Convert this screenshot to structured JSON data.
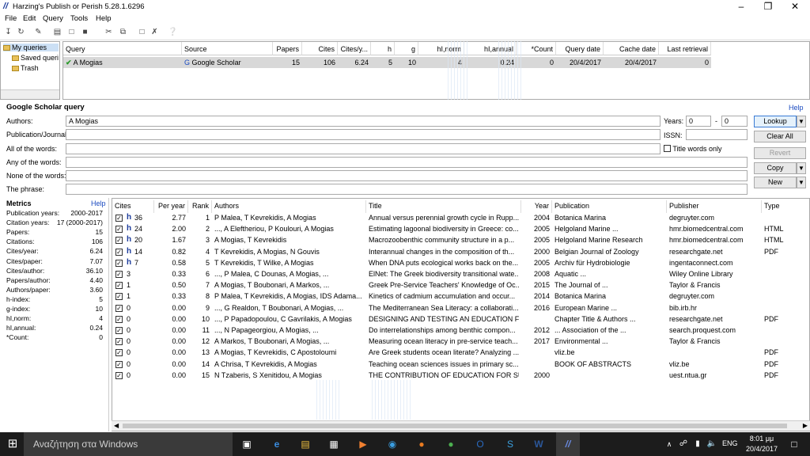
{
  "window": {
    "title": "Harzing's Publish or Perish 5.28.1.6296",
    "logo": "//"
  },
  "menu": [
    "File",
    "Edit",
    "Query",
    "Tools",
    "Help"
  ],
  "tree": {
    "items": [
      "My queries",
      "Saved queri",
      "Trash"
    ]
  },
  "queries": {
    "headers": [
      "Query",
      "Source",
      "Papers",
      "Cites",
      "Cites/y...",
      "h",
      "g",
      "hI,norm",
      "hI,annual",
      "*Count",
      "Query date",
      "Cache date",
      "Last retrieval"
    ],
    "row": [
      "A Mogias",
      "Google Scholar",
      "15",
      "106",
      "6.24",
      "5",
      "10",
      "4",
      "0.24",
      "0",
      "20/4/2017",
      "20/4/2017",
      "0"
    ]
  },
  "form": {
    "title": "Google Scholar query",
    "help": "Help",
    "authors_label": "Authors:",
    "authors_value": "A Mogias",
    "pub_label": "Publication/Journal:",
    "all_label": "All of the words:",
    "any_label": "Any of the words:",
    "none_label": "None of the words:",
    "phrase_label": "The phrase:",
    "years_label": "Years:",
    "year_from": "0",
    "year_dash": "-",
    "year_to": "0",
    "issn_label": "ISSN:",
    "title_words_label": "Title words only",
    "buttons": {
      "lookup": "Lookup",
      "clear": "Clear All",
      "revert": "Revert",
      "copy": "Copy",
      "new": "New"
    }
  },
  "metrics": {
    "title": "Metrics",
    "help": "Help",
    "rows": [
      [
        "Publication years:",
        "2000-2017"
      ],
      [
        "Citation years:",
        "17 (2000-2017)"
      ],
      [
        "Papers:",
        "15"
      ],
      [
        "Citations:",
        "106"
      ],
      [
        "Cites/year:",
        "6.24"
      ],
      [
        "Cites/paper:",
        "7.07"
      ],
      [
        "Cites/author:",
        "36.10"
      ],
      [
        "Papers/author:",
        "4.40"
      ],
      [
        "Authors/paper:",
        "3.60"
      ],
      [
        "h-index:",
        "5"
      ],
      [
        "g-index:",
        "10"
      ],
      [
        "hI,norm:",
        "4"
      ],
      [
        "hI,annual:",
        "0.24"
      ],
      [
        "*Count:",
        "0"
      ]
    ]
  },
  "results": {
    "headers": [
      "Cites",
      "Per year",
      "Rank",
      "Authors",
      "Title",
      "Year",
      "Publication",
      "Publisher",
      "Type"
    ],
    "rows": [
      [
        "✓",
        "h",
        "36",
        "2.77",
        "1",
        "P Malea, T Kevrekidis, A Mogias",
        "Annual versus perennial growth cycle in Rupp...",
        "2004",
        "Botanica Marina",
        "degruyter.com",
        ""
      ],
      [
        "✓",
        "h",
        "24",
        "2.00",
        "2",
        "..., A Eleftheriou, P Koulouri, A Mogias",
        "Estimating lagoonal biodiversity in Greece: co...",
        "2005",
        "Helgoland Marine ...",
        "hmr.biomedcentral.com",
        "HTML"
      ],
      [
        "✓",
        "h",
        "20",
        "1.67",
        "3",
        "A Mogias, T Kevrekidis",
        "Macrozoobenthic community structure in a p...",
        "2005",
        "Helgoland Marine Research",
        "hmr.biomedcentral.com",
        "HTML"
      ],
      [
        "✓",
        "h",
        "14",
        "0.82",
        "4",
        "T Kevrekidis, A Mogias, N Gouvis",
        "Interannual changes in the composition of th...",
        "2000",
        "Belgian Journal of Zoology",
        "researchgate.net",
        "PDF"
      ],
      [
        "✓",
        "h",
        "7",
        "0.58",
        "5",
        "T Kevrekidis, T Wilke, A Mogias",
        "When DNA puts ecological works back on the...",
        "2005",
        "Archiv für Hydrobiologie",
        "ingentaconnect.com",
        ""
      ],
      [
        "✓",
        "",
        "3",
        "0.33",
        "6",
        "..., P Malea, C Dounas, A Mogias, ...",
        "ElNet: The Greek biodiversity transitional wate...",
        "2008",
        "Aquatic ...",
        "Wiley Online Library",
        ""
      ],
      [
        "✓",
        "",
        "1",
        "0.50",
        "7",
        "A Mogias, T Boubonari, A Markos, ...",
        "Greek Pre-Service Teachers' Knowledge of Oc...",
        "2015",
        "The Journal of ...",
        "Taylor & Francis",
        ""
      ],
      [
        "✓",
        "",
        "1",
        "0.33",
        "8",
        "P Malea, T Kevrekidis, A Mogias, IDS Adama...",
        "Kinetics of cadmium accumulation and occur...",
        "2014",
        "Botanica Marina",
        "degruyter.com",
        ""
      ],
      [
        "✓",
        "",
        "0",
        "0.00",
        "9",
        "..., G Realdon, T Boubonari, A Mogias, ...",
        "The Mediterranean Sea Literacy: a collaborati...",
        "2016",
        "European Marine ...",
        "bib.irb.hr",
        ""
      ],
      [
        "✓",
        "",
        "0",
        "0.00",
        "10",
        "..., P Papadopoulou, C Gavrilakis, A Mogias",
        "DESIGNING AND TESTING AN EDUCATION F...",
        "",
        "Chapter Title & Authors ...",
        "researchgate.net",
        "PDF"
      ],
      [
        "✓",
        "",
        "0",
        "0.00",
        "11",
        "..., N Papageorgiou, A Mogias, ...",
        "Do interrelationships among benthic compon...",
        "2012",
        "... Association of the ...",
        "search.proquest.com",
        ""
      ],
      [
        "✓",
        "",
        "0",
        "0.00",
        "12",
        "A Markos, T Boubonari, A Mogias, ...",
        "Measuring ocean literacy in pre-service teach...",
        "2017",
        "Environmental ...",
        "Taylor & Francis",
        ""
      ],
      [
        "✓",
        "",
        "0",
        "0.00",
        "13",
        "A Mogias, T Kevrekidis, C Apostoloumi",
        "Are Greek students ocean literate? Analyzing ...",
        "",
        "vliz.be",
        "",
        "PDF"
      ],
      [
        "✓",
        "",
        "0",
        "0.00",
        "14",
        "A Chrisa, T Kevrekidis, A Mogias",
        "Teaching ocean sciences issues in primary sc...",
        "",
        "BOOK OF ABSTRACTS",
        "vliz.be",
        "PDF"
      ],
      [
        "✓",
        "",
        "0",
        "0.00",
        "15",
        "N Tzaberis, S Xenitidou, A Mogias",
        "THE CONTRIBUTION OF EDUCATION FOR SU...",
        "2000",
        "",
        "uest.ntua.gr",
        "PDF"
      ]
    ]
  },
  "taskbar": {
    "search": "Αναζήτηση στα Windows",
    "time": "8:01 μμ",
    "date": "20/4/2017",
    "lang": "ENG"
  }
}
